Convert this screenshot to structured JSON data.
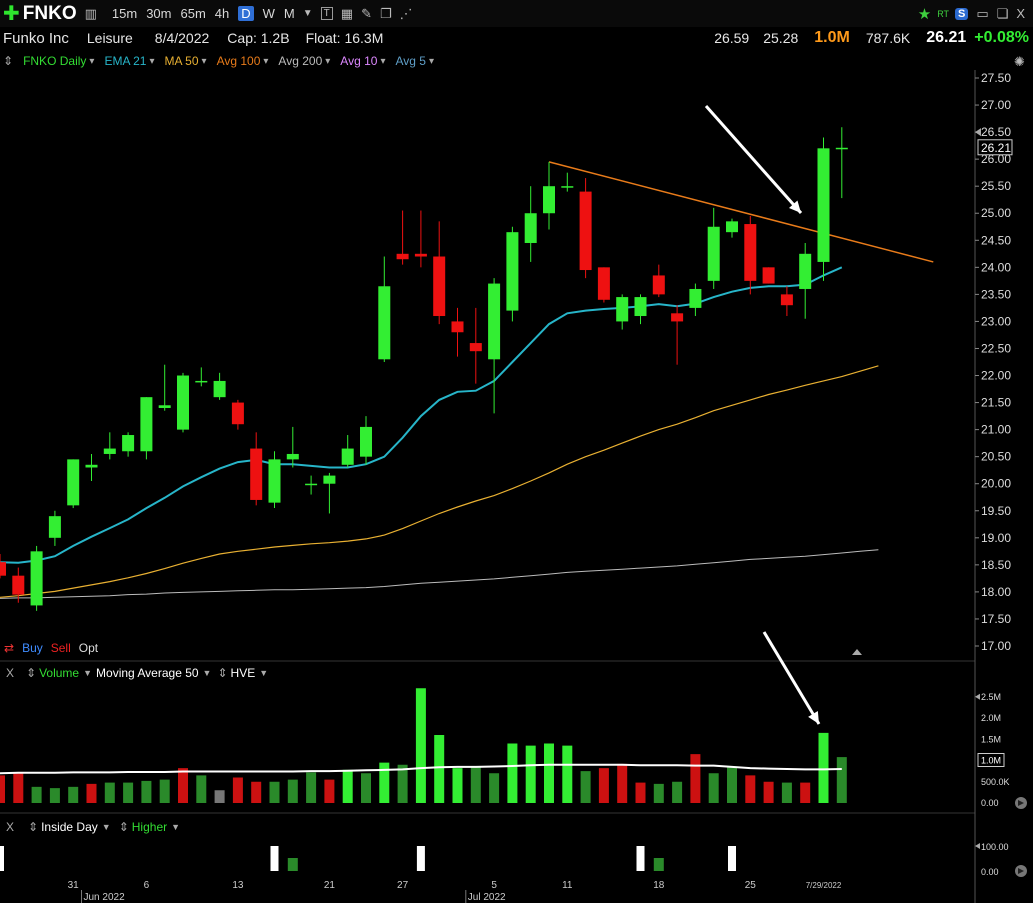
{
  "toolbar": {
    "symbol": "FNKO",
    "intervals": [
      "15m",
      "30m",
      "65m",
      "4h",
      "D",
      "W",
      "M"
    ],
    "active_interval": "D",
    "right_icons": [
      "star-icon",
      "rt-badge",
      "s-badge",
      "save-icon",
      "restore-icon",
      "close-icon"
    ],
    "rt_label": "RT",
    "s_label": "S",
    "close_label": "X"
  },
  "info": {
    "name": "Funko Inc",
    "sector": "Leisure",
    "date": "8/4/2022",
    "cap": "Cap: 1.2B",
    "float": "Float: 16.3M",
    "high": "26.59",
    "low": "25.28",
    "volume": "1.0M",
    "avg_volume": "787.6K",
    "price": "26.21",
    "change": "+0.08%"
  },
  "legend": [
    {
      "label": "FNKO Daily",
      "color": "#33dd33"
    },
    {
      "label": "EMA 21",
      "color": "#27b5c9"
    },
    {
      "label": "MA 50",
      "color": "#e8b032"
    },
    {
      "label": "Avg 100",
      "color": "#e87b1a"
    },
    {
      "label": "Avg 200",
      "color": "#bbbbbb"
    },
    {
      "label": "Avg 10",
      "color": "#dd88ff"
    },
    {
      "label": "Avg 5",
      "color": "#5f9fc8"
    }
  ],
  "order_buttons": {
    "buy": "Buy",
    "sell": "Sell",
    "opt": "Opt"
  },
  "volume_panel": {
    "x": "X",
    "labels": [
      "Volume",
      "Moving Average 50",
      "HVE"
    ]
  },
  "inside_panel": {
    "x": "X",
    "labels": [
      "Inside Day",
      "Higher"
    ]
  },
  "colors": {
    "up": "#33ee33",
    "down": "#ee1111",
    "ema21": "#27b5c9",
    "ma50": "#e8b032",
    "avg200": "#bbbbbb",
    "trend": "#e87b1a",
    "vol_up_hi": "#33ee33",
    "vol_up": "#2a8a2a",
    "vol_down": "#cc1111",
    "vol_flat": "#777777"
  },
  "chart_data": {
    "type": "candlestick",
    "price_axis": {
      "min": 17.0,
      "max": 27.5,
      "ticks": [
        "27.50",
        "27.00",
        "26.50",
        "26.00",
        "25.50",
        "25.00",
        "24.50",
        "24.00",
        "23.50",
        "23.00",
        "22.50",
        "22.00",
        "21.50",
        "21.00",
        "20.50",
        "20.00",
        "19.50",
        "19.00",
        "18.50",
        "18.00",
        "17.50",
        "17.00"
      ]
    },
    "last_price_label": "26.21",
    "date_ticks": [
      {
        "label": "31",
        "index": 4
      },
      {
        "label": "Jun 2022",
        "index": 5
      },
      {
        "label": "6",
        "index": 8
      },
      {
        "label": "13",
        "index": 13
      },
      {
        "label": "21",
        "index": 18
      },
      {
        "label": "27",
        "index": 22
      },
      {
        "label": "Jul 2022",
        "index": 26
      },
      {
        "label": "5",
        "index": 27
      },
      {
        "label": "11",
        "index": 31
      },
      {
        "label": "18",
        "index": 36
      },
      {
        "label": "25",
        "index": 41
      },
      {
        "label": "7/29/2022",
        "index": 45
      }
    ],
    "candles": [
      {
        "o": 18.55,
        "h": 18.7,
        "l": 18.25,
        "c": 18.3
      },
      {
        "o": 18.3,
        "h": 18.45,
        "l": 17.8,
        "c": 17.95
      },
      {
        "o": 17.75,
        "h": 18.85,
        "l": 17.65,
        "c": 18.75
      },
      {
        "o": 19.0,
        "h": 19.5,
        "l": 18.85,
        "c": 19.4
      },
      {
        "o": 19.6,
        "h": 20.45,
        "l": 19.55,
        "c": 20.45
      },
      {
        "o": 20.3,
        "h": 20.55,
        "l": 20.05,
        "c": 20.35
      },
      {
        "o": 20.55,
        "h": 20.95,
        "l": 20.45,
        "c": 20.65
      },
      {
        "o": 20.6,
        "h": 20.95,
        "l": 20.5,
        "c": 20.9
      },
      {
        "o": 20.6,
        "h": 21.6,
        "l": 20.45,
        "c": 21.6
      },
      {
        "o": 21.4,
        "h": 22.2,
        "l": 21.35,
        "c": 21.45
      },
      {
        "o": 21.0,
        "h": 22.05,
        "l": 20.95,
        "c": 22.0
      },
      {
        "o": 21.9,
        "h": 22.15,
        "l": 21.8,
        "c": 21.9
      },
      {
        "o": 21.6,
        "h": 22.05,
        "l": 21.55,
        "c": 21.9
      },
      {
        "o": 21.5,
        "h": 21.55,
        "l": 21.0,
        "c": 21.1
      },
      {
        "o": 20.65,
        "h": 20.95,
        "l": 19.6,
        "c": 19.7
      },
      {
        "o": 19.65,
        "h": 20.6,
        "l": 19.55,
        "c": 20.45
      },
      {
        "o": 20.45,
        "h": 21.05,
        "l": 20.3,
        "c": 20.55
      },
      {
        "o": 20.0,
        "h": 20.15,
        "l": 19.8,
        "c": 20.0
      },
      {
        "o": 20.0,
        "h": 20.2,
        "l": 19.45,
        "c": 20.15
      },
      {
        "o": 20.35,
        "h": 20.9,
        "l": 20.3,
        "c": 20.65
      },
      {
        "o": 20.5,
        "h": 21.25,
        "l": 20.35,
        "c": 21.05
      },
      {
        "o": 22.3,
        "h": 24.2,
        "l": 22.25,
        "c": 23.65
      },
      {
        "o": 24.25,
        "h": 25.05,
        "l": 24.05,
        "c": 24.15
      },
      {
        "o": 24.25,
        "h": 25.05,
        "l": 24.0,
        "c": 24.2
      },
      {
        "o": 24.2,
        "h": 24.85,
        "l": 22.95,
        "c": 23.1
      },
      {
        "o": 23.0,
        "h": 23.25,
        "l": 22.35,
        "c": 22.8
      },
      {
        "o": 22.6,
        "h": 23.25,
        "l": 21.85,
        "c": 22.45
      },
      {
        "o": 22.3,
        "h": 23.8,
        "l": 21.3,
        "c": 23.7
      },
      {
        "o": 23.2,
        "h": 24.75,
        "l": 23.0,
        "c": 24.65
      },
      {
        "o": 24.45,
        "h": 25.5,
        "l": 24.1,
        "c": 25.0
      },
      {
        "o": 25.0,
        "h": 25.95,
        "l": 24.7,
        "c": 25.5
      },
      {
        "o": 25.5,
        "h": 25.75,
        "l": 25.4,
        "c": 25.5
      },
      {
        "o": 25.4,
        "h": 25.65,
        "l": 23.8,
        "c": 23.95
      },
      {
        "o": 24.0,
        "h": 24.0,
        "l": 23.35,
        "c": 23.4
      },
      {
        "o": 23.0,
        "h": 23.5,
        "l": 22.85,
        "c": 23.45
      },
      {
        "o": 23.1,
        "h": 23.5,
        "l": 22.95,
        "c": 23.45
      },
      {
        "o": 23.85,
        "h": 24.05,
        "l": 23.45,
        "c": 23.5
      },
      {
        "o": 23.15,
        "h": 23.3,
        "l": 22.2,
        "c": 23.0
      },
      {
        "o": 23.25,
        "h": 23.7,
        "l": 23.1,
        "c": 23.6
      },
      {
        "o": 23.75,
        "h": 25.1,
        "l": 23.6,
        "c": 24.75
      },
      {
        "o": 24.65,
        "h": 24.9,
        "l": 24.55,
        "c": 24.85
      },
      {
        "o": 24.8,
        "h": 24.95,
        "l": 23.5,
        "c": 23.75
      },
      {
        "o": 24.0,
        "h": 24.0,
        "l": 23.7,
        "c": 23.7
      },
      {
        "o": 23.5,
        "h": 23.65,
        "l": 23.1,
        "c": 23.3
      },
      {
        "o": 23.6,
        "h": 24.45,
        "l": 23.05,
        "c": 24.25
      },
      {
        "o": 24.1,
        "h": 26.4,
        "l": 23.75,
        "c": 26.2
      },
      {
        "o": 26.2,
        "h": 26.59,
        "l": 25.28,
        "c": 26.21
      }
    ],
    "ema21": [
      18.55,
      18.54,
      18.58,
      18.66,
      18.85,
      19.02,
      19.18,
      19.34,
      19.55,
      19.74,
      19.95,
      20.12,
      20.28,
      20.4,
      20.44,
      20.36,
      20.36,
      20.33,
      20.3,
      20.3,
      20.36,
      20.5,
      20.85,
      21.25,
      21.55,
      21.7,
      21.72,
      21.9,
      22.25,
      22.6,
      22.95,
      23.15,
      23.2,
      23.23,
      23.25,
      23.28,
      23.32,
      23.28,
      23.33,
      23.45,
      23.55,
      23.62,
      23.65,
      23.65,
      23.68,
      23.85,
      24.0
    ],
    "ma50": [
      17.9,
      17.93,
      17.97,
      18.01,
      18.07,
      18.13,
      18.19,
      18.26,
      18.34,
      18.43,
      18.53,
      18.62,
      18.7,
      18.75,
      18.79,
      18.83,
      18.86,
      18.89,
      18.91,
      18.94,
      18.98,
      19.05,
      19.17,
      19.31,
      19.45,
      19.57,
      19.68,
      19.78,
      19.91,
      20.05,
      20.2,
      20.36,
      20.5,
      20.62,
      20.75,
      20.88,
      21.0,
      21.1,
      21.22,
      21.35,
      21.45,
      21.55,
      21.65,
      21.73,
      21.82,
      21.9,
      21.98,
      22.08,
      22.18
    ],
    "avg200": [
      17.88,
      17.89,
      17.89,
      17.9,
      17.91,
      17.92,
      17.93,
      17.95,
      17.96,
      17.98,
      17.99,
      18.0,
      18.01,
      18.02,
      18.03,
      18.04,
      18.04,
      18.05,
      18.06,
      18.07,
      18.08,
      18.1,
      18.13,
      18.16,
      18.18,
      18.2,
      18.22,
      18.24,
      18.27,
      18.3,
      18.33,
      18.36,
      18.38,
      18.4,
      18.42,
      18.44,
      18.46,
      18.48,
      18.51,
      18.54,
      18.57,
      18.6,
      18.62,
      18.64,
      18.66,
      18.69,
      18.72,
      18.75,
      18.78
    ],
    "trendline": {
      "from": {
        "index": 30,
        "value": 25.95
      },
      "to": {
        "index": 51,
        "value": 24.1
      }
    },
    "volume_axis": {
      "min": 0,
      "max": 2.8,
      "ticks": [
        "2.5M",
        "2.0M",
        "1.5M",
        "1.0M",
        "500.0K",
        "0.00"
      ]
    },
    "volume_label": "1.0M",
    "volumes": [
      0.65,
      0.72,
      0.38,
      0.35,
      0.38,
      0.45,
      0.48,
      0.48,
      0.52,
      0.55,
      0.82,
      0.65,
      0.3,
      0.6,
      0.5,
      0.5,
      0.55,
      0.72,
      0.55,
      0.78,
      0.7,
      0.95,
      0.9,
      2.7,
      1.6,
      0.82,
      0.85,
      0.7,
      1.4,
      1.35,
      1.4,
      1.35,
      0.75,
      0.82,
      0.92,
      0.48,
      0.45,
      0.5,
      1.15,
      0.7,
      0.85,
      0.65,
      0.5,
      0.48,
      0.48,
      1.65,
      1.08
    ],
    "volume_colors": [
      "down",
      "down",
      "up",
      "up",
      "up",
      "down",
      "up",
      "up",
      "up",
      "up",
      "down",
      "up",
      "flat",
      "down",
      "down",
      "up",
      "up",
      "up",
      "down",
      "up_hi",
      "up",
      "up_hi",
      "up",
      "up_hi",
      "up_hi",
      "up_hi",
      "up",
      "up",
      "up_hi",
      "up_hi",
      "up_hi",
      "up_hi",
      "up",
      "down",
      "down",
      "down",
      "up",
      "up",
      "down",
      "up",
      "up",
      "down",
      "down",
      "up",
      "down",
      "up_hi",
      "up"
    ],
    "volume_ma": [
      0.7,
      0.71,
      0.71,
      0.71,
      0.72,
      0.72,
      0.72,
      0.73,
      0.73,
      0.73,
      0.74,
      0.74,
      0.74,
      0.74,
      0.74,
      0.74,
      0.74,
      0.75,
      0.75,
      0.76,
      0.77,
      0.78,
      0.79,
      0.82,
      0.84,
      0.85,
      0.85,
      0.86,
      0.87,
      0.89,
      0.9,
      0.9,
      0.9,
      0.9,
      0.9,
      0.89,
      0.89,
      0.89,
      0.88,
      0.88,
      0.85,
      0.82,
      0.81,
      0.8,
      0.79,
      0.79,
      0.8
    ],
    "inside_axis": {
      "min": 0,
      "max": 100,
      "ticks": [
        "100.00",
        "0.00"
      ]
    },
    "inside_white": [
      0,
      15,
      23,
      35,
      40
    ],
    "inside_green": [
      16,
      36
    ]
  }
}
